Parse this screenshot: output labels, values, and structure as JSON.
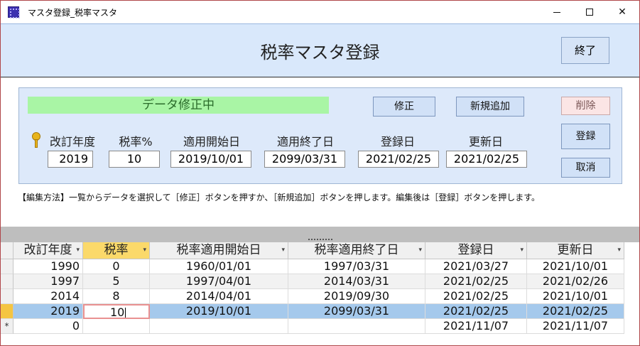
{
  "window": {
    "title": "マスタ登録_税率マスタ",
    "icon": "access-form-icon"
  },
  "header": {
    "title": "税率マスタ登録",
    "exit_label": "終了"
  },
  "panel": {
    "status_text": "データ修正中",
    "modify_label": "修正",
    "add_label": "新規追加",
    "delete_label": "削除",
    "save_label": "登録",
    "cancel_label": "取消",
    "fields": {
      "revision_year": {
        "label": "改訂年度",
        "value": "2019"
      },
      "tax_rate": {
        "label": "税率%",
        "value": "10"
      },
      "start_date": {
        "label": "適用開始日",
        "value": "2019/10/01"
      },
      "end_date": {
        "label": "適用終了日",
        "value": "2099/03/31"
      },
      "created_date": {
        "label": "登録日",
        "value": "2021/02/25"
      },
      "updated_date": {
        "label": "更新日",
        "value": "2021/02/25"
      }
    }
  },
  "help_text": "【編集方法】一覧からデータを選択して［修正］ボタンを押すか、［新規追加］ボタンを押します。編集後は［登録］ボタンを押します。",
  "table": {
    "columns": [
      "改訂年度",
      "税率",
      "税率適用開始日",
      "税率適用終了日",
      "登録日",
      "更新日"
    ],
    "dropdown_glyph": "▾",
    "rows": [
      {
        "selector": "",
        "cells": [
          "1990",
          "0",
          "1960/01/01",
          "1997/03/31",
          "2021/03/27",
          "2021/10/01"
        ]
      },
      {
        "selector": "",
        "cells": [
          "1997",
          "5",
          "1997/04/01",
          "2014/03/31",
          "2021/02/25",
          "2021/02/26"
        ]
      },
      {
        "selector": "",
        "cells": [
          "2014",
          "8",
          "2014/04/01",
          "2019/09/30",
          "2021/02/25",
          "2021/10/01"
        ]
      },
      {
        "selector": "",
        "cells": [
          "2019",
          "10",
          "2019/10/01",
          "2099/03/31",
          "2021/02/25",
          "2021/02/25"
        ]
      },
      {
        "selector": "*",
        "cells": [
          "0",
          "",
          "",
          "",
          "2021/11/07",
          "2021/11/07"
        ]
      }
    ]
  },
  "colors": {
    "header_bg": "#d9e8fb",
    "status_green": "#a9f5a5",
    "selected_row": "#a5c9ec",
    "selected_column_header": "#fbd96a"
  }
}
